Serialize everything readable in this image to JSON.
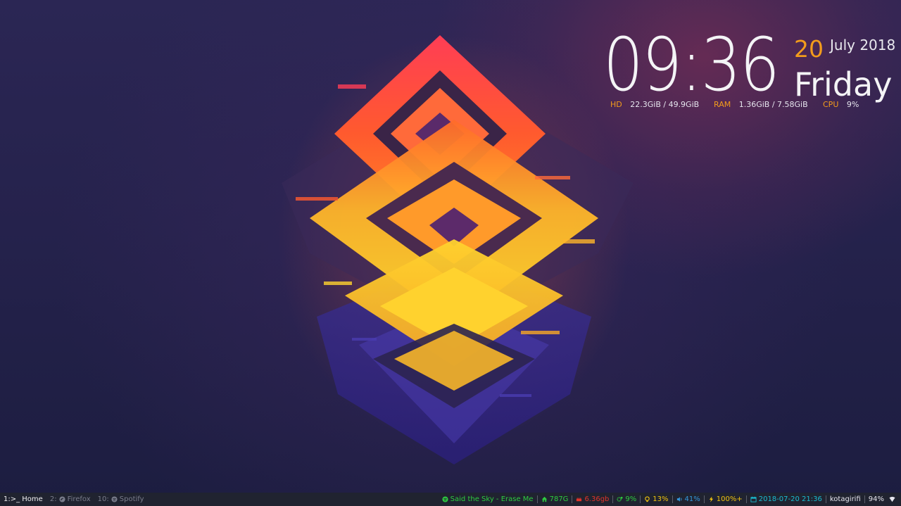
{
  "conky": {
    "time": "09:36",
    "day": "20",
    "month_year": "July 2018",
    "weekday": "Friday",
    "stats": [
      {
        "label": "HD",
        "value": "22.3GiB / 49.9GiB"
      },
      {
        "label": "RAM",
        "value": "1.36GiB / 7.58GiB"
      },
      {
        "label": "CPU",
        "value": "9%"
      }
    ],
    "colors": {
      "accent": "#f39c1c",
      "text": "#f4f4f6"
    }
  },
  "bar": {
    "workspaces": [
      {
        "label": "1:>_ Home",
        "active": true
      },
      {
        "num": "2:",
        "label": "Firefox",
        "icon": "firefox-icon",
        "active": false
      },
      {
        "num": "10:",
        "label": "Spotify",
        "icon": "spotify-icon",
        "active": false
      }
    ],
    "modules": {
      "spotify": {
        "text": "Said the Sky - Erase Me",
        "icon": "spotify-icon",
        "color": "#2ecc40"
      },
      "disk": {
        "text": "787G",
        "icon": "home-icon",
        "color": "#2ecc40"
      },
      "memory": {
        "text": "6.36gb",
        "icon": "memory-icon",
        "color": "#e0342a"
      },
      "cpu": {
        "text": "9%",
        "icon": "cogs-icon",
        "color": "#2ecc40"
      },
      "brightness": {
        "text": "13%",
        "icon": "lightbulb-icon",
        "color": "#f1c40f"
      },
      "volume": {
        "text": "41%",
        "icon": "volume-icon",
        "color": "#3498db"
      },
      "battery": {
        "text": "100%+",
        "icon": "bolt-icon",
        "color": "#f1c40f"
      },
      "date": {
        "text": "2018-07-20 21:36",
        "icon": "calendar-icon",
        "color": "#1abcd0"
      },
      "user": {
        "text": "kotagirifi"
      },
      "wifi": {
        "text": "94%",
        "icon": "wifi-icon"
      }
    }
  }
}
